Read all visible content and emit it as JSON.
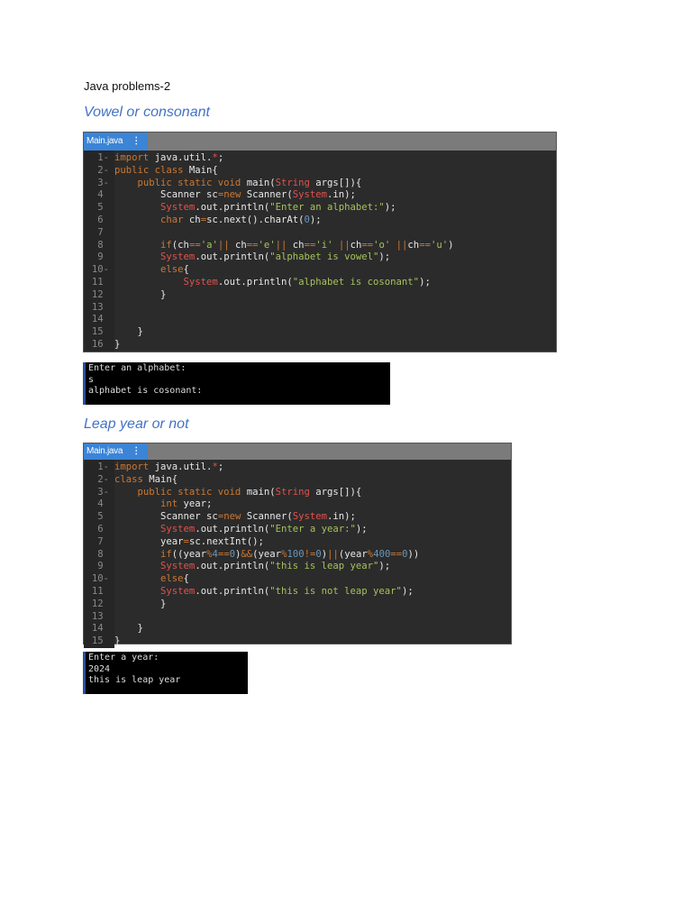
{
  "doc_title": "Java problems-2",
  "sections": [
    {
      "heading": "Vowel or consonant",
      "tab": "Main.java",
      "tab_menu": "⋮",
      "lines": [
        [
          [
            "import",
            "k"
          ],
          [
            " java.util.",
            "p"
          ],
          [
            "*",
            "r"
          ],
          [
            ";",
            "p"
          ]
        ],
        [
          [
            "public class",
            "k"
          ],
          [
            " Main{",
            "p"
          ]
        ],
        [
          [
            "    public static void",
            "k"
          ],
          [
            " main(",
            "p"
          ],
          [
            "String",
            "r"
          ],
          [
            " args[]){",
            "p"
          ]
        ],
        [
          [
            "        Scanner sc",
            "p"
          ],
          [
            "=new",
            "k"
          ],
          [
            " Scanner(",
            "p"
          ],
          [
            "System",
            "r"
          ],
          [
            ".in);",
            "p"
          ]
        ],
        [
          [
            "        ",
            "p"
          ],
          [
            "System",
            "r"
          ],
          [
            ".out.println(",
            "p"
          ],
          [
            "\"Enter an alphabet:\"",
            "s"
          ],
          [
            ");",
            "p"
          ]
        ],
        [
          [
            "        ",
            "p"
          ],
          [
            "char",
            "k"
          ],
          [
            " ch",
            "p"
          ],
          [
            "=",
            "k"
          ],
          [
            "sc.next().charAt(",
            "p"
          ],
          [
            "0",
            "n"
          ],
          [
            ");",
            "p"
          ]
        ],
        [],
        [
          [
            "        ",
            "p"
          ],
          [
            "if",
            "k"
          ],
          [
            "(ch",
            "p"
          ],
          [
            "==",
            "k"
          ],
          [
            "'a'",
            "s"
          ],
          [
            "||",
            "k"
          ],
          [
            " ch",
            "p"
          ],
          [
            "==",
            "k"
          ],
          [
            "'e'",
            "s"
          ],
          [
            "||",
            "k"
          ],
          [
            " ch",
            "p"
          ],
          [
            "==",
            "k"
          ],
          [
            "'i'",
            "s"
          ],
          [
            " ||",
            "k"
          ],
          [
            "ch",
            "p"
          ],
          [
            "==",
            "k"
          ],
          [
            "'o'",
            "s"
          ],
          [
            " ||",
            "k"
          ],
          [
            "ch",
            "p"
          ],
          [
            "==",
            "k"
          ],
          [
            "'u'",
            "s"
          ],
          [
            ")",
            "p"
          ]
        ],
        [
          [
            "        ",
            "p"
          ],
          [
            "System",
            "r"
          ],
          [
            ".out.println(",
            "p"
          ],
          [
            "\"alphabet is vowel\"",
            "s"
          ],
          [
            ");",
            "p"
          ]
        ],
        [
          [
            "        ",
            "p"
          ],
          [
            "else",
            "k"
          ],
          [
            "{",
            "p"
          ]
        ],
        [
          [
            "            ",
            "p"
          ],
          [
            "System",
            "r"
          ],
          [
            ".out.println(",
            "p"
          ],
          [
            "\"alphabet is cosonant\"",
            "s"
          ],
          [
            ");",
            "p"
          ]
        ],
        [
          [
            "        }",
            "p"
          ]
        ],
        [],
        [],
        [
          [
            "    }",
            "p"
          ]
        ],
        [
          [
            "}",
            "p"
          ]
        ]
      ],
      "folds": [
        1,
        2,
        3,
        10
      ],
      "output": [
        "Enter an alphabet:",
        "s",
        "alphabet is cosonant:"
      ]
    },
    {
      "heading": "Leap year or not",
      "tab": "Main.java",
      "tab_menu": "⋮",
      "lines": [
        [
          [
            "import",
            "k"
          ],
          [
            " java.util.",
            "p"
          ],
          [
            "*",
            "r"
          ],
          [
            ";",
            "p"
          ]
        ],
        [
          [
            "class",
            "k"
          ],
          [
            " Main{",
            "p"
          ]
        ],
        [
          [
            "    public static void",
            "k"
          ],
          [
            " main(",
            "p"
          ],
          [
            "String",
            "r"
          ],
          [
            " args[]){",
            "p"
          ]
        ],
        [
          [
            "        ",
            "p"
          ],
          [
            "int",
            "k"
          ],
          [
            " year;",
            "p"
          ]
        ],
        [
          [
            "        Scanner sc",
            "p"
          ],
          [
            "=new",
            "k"
          ],
          [
            " Scanner(",
            "p"
          ],
          [
            "System",
            "r"
          ],
          [
            ".in);",
            "p"
          ]
        ],
        [
          [
            "        ",
            "p"
          ],
          [
            "System",
            "r"
          ],
          [
            ".out.println(",
            "p"
          ],
          [
            "\"Enter a year:\"",
            "s"
          ],
          [
            ");",
            "p"
          ]
        ],
        [
          [
            "        year",
            "p"
          ],
          [
            "=",
            "k"
          ],
          [
            "sc.nextInt();",
            "p"
          ]
        ],
        [
          [
            "        ",
            "p"
          ],
          [
            "if",
            "k"
          ],
          [
            "((year",
            "p"
          ],
          [
            "%",
            "k"
          ],
          [
            "4",
            "n"
          ],
          [
            "==",
            "k"
          ],
          [
            "0",
            "n"
          ],
          [
            ")",
            "p"
          ],
          [
            "&&",
            "k"
          ],
          [
            "(year",
            "p"
          ],
          [
            "%",
            "k"
          ],
          [
            "100",
            "n"
          ],
          [
            "!=",
            "k"
          ],
          [
            "0",
            "n"
          ],
          [
            ")",
            "p"
          ],
          [
            "||",
            "k"
          ],
          [
            "(year",
            "p"
          ],
          [
            "%",
            "k"
          ],
          [
            "400",
            "n"
          ],
          [
            "==",
            "k"
          ],
          [
            "0",
            "n"
          ],
          [
            "))",
            "p"
          ]
        ],
        [
          [
            "        ",
            "p"
          ],
          [
            "System",
            "r"
          ],
          [
            ".out.println(",
            "p"
          ],
          [
            "\"this is leap year\"",
            "s"
          ],
          [
            ");",
            "p"
          ]
        ],
        [
          [
            "        ",
            "p"
          ],
          [
            "else",
            "k"
          ],
          [
            "{",
            "p"
          ]
        ],
        [
          [
            "        ",
            "p"
          ],
          [
            "System",
            "r"
          ],
          [
            ".out.println(",
            "p"
          ],
          [
            "\"this is not leap year\"",
            "s"
          ],
          [
            ");",
            "p"
          ]
        ],
        [
          [
            "        }",
            "p"
          ]
        ],
        [],
        [
          [
            "    }",
            "p"
          ]
        ],
        [
          [
            "}",
            "p"
          ]
        ]
      ],
      "folds": [
        1,
        2,
        3,
        10
      ],
      "output": [
        "Enter a year:",
        "2024",
        "this is leap year"
      ]
    }
  ]
}
